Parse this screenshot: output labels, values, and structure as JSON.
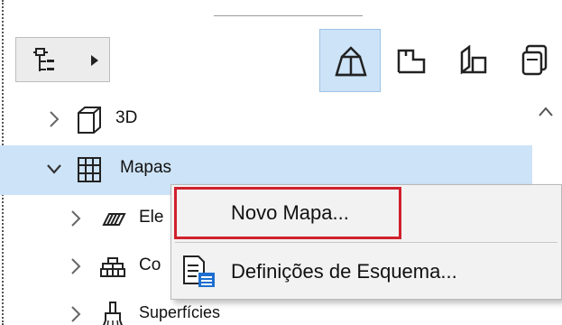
{
  "toolbar": {
    "navigator_button": "navigator-tree",
    "tabs": [
      {
        "icon": "3d-building-icon",
        "active": true
      },
      {
        "icon": "plan-icon",
        "active": false
      },
      {
        "icon": "elevation-icon",
        "active": false
      },
      {
        "icon": "stack-icon",
        "active": false
      }
    ]
  },
  "tree": {
    "items": [
      {
        "label": "3D",
        "expanded": false,
        "icon": "3d-box-icon"
      },
      {
        "label": "Mapas",
        "expanded": true,
        "selected": true,
        "icon": "grid-table-icon"
      },
      {
        "label": "Ele",
        "expanded": false,
        "icon": "hatch-icon"
      },
      {
        "label": "Co",
        "expanded": false,
        "icon": "components-icon"
      },
      {
        "label": "Superfícies",
        "expanded": false,
        "icon": "brush-icon"
      }
    ]
  },
  "context_menu": {
    "items": [
      {
        "label": "Novo Mapa...",
        "highlighted": true
      },
      {
        "label": "Definições de Esquema...",
        "icon": "scheme-settings-icon"
      }
    ]
  },
  "colors": {
    "selection": "#cde3f7",
    "highlight_border": "#d0212d"
  }
}
